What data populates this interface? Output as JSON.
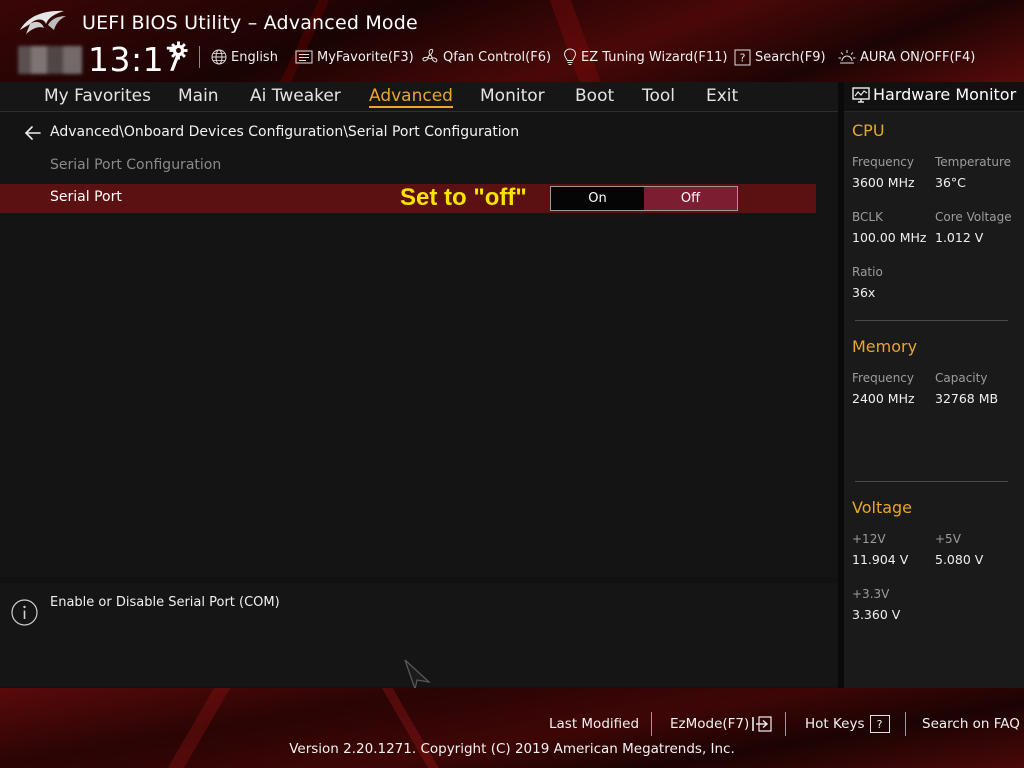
{
  "header": {
    "title": "UEFI BIOS Utility – Advanced Mode",
    "clock": "13:17",
    "items": {
      "language": "English",
      "my_favorite": "MyFavorite(F3)",
      "qfan": "Qfan Control(F6)",
      "ez_tuning": "EZ Tuning Wizard(F11)",
      "search": "Search(F9)",
      "aura": "AURA ON/OFF(F4)"
    }
  },
  "menu": {
    "tabs": [
      "My Favorites",
      "Main",
      "Ai Tweaker",
      "Advanced",
      "Monitor",
      "Boot",
      "Tool",
      "Exit"
    ],
    "active": "Advanced"
  },
  "main": {
    "breadcrumb": "Advanced\\Onboard Devices Configuration\\Serial Port Configuration",
    "section_label": "Serial Port Configuration",
    "setting": {
      "label": "Serial Port",
      "annotation": "Set to \"off\"",
      "options": [
        "On",
        "Off"
      ],
      "selected": "Off"
    }
  },
  "help": {
    "text": "Enable or Disable Serial Port (COM)"
  },
  "hardware_monitor": {
    "title": "Hardware Monitor",
    "cpu": {
      "heading": "CPU",
      "frequency_label": "Frequency",
      "frequency": "3600 MHz",
      "temperature_label": "Temperature",
      "temperature": "36°C",
      "bclk_label": "BCLK",
      "bclk": "100.00 MHz",
      "core_voltage_label": "Core Voltage",
      "core_voltage": "1.012 V",
      "ratio_label": "Ratio",
      "ratio": "36x"
    },
    "memory": {
      "heading": "Memory",
      "frequency_label": "Frequency",
      "frequency": "2400 MHz",
      "capacity_label": "Capacity",
      "capacity": "32768 MB"
    },
    "voltage": {
      "heading": "Voltage",
      "v12_label": "+12V",
      "v12": "11.904 V",
      "v5_label": "+5V",
      "v5": "5.080 V",
      "v33_label": "+3.3V",
      "v33": "3.360 V"
    }
  },
  "footer": {
    "last_modified": "Last Modified",
    "ez_mode": "EzMode(F7)",
    "hot_keys": "Hot Keys",
    "hot_keys_key": "?",
    "search_faq": "Search on FAQ",
    "copyright": "Version 2.20.1271. Copyright (C) 2019 American Megatrends, Inc."
  },
  "colors": {
    "accent": "#e9a62b",
    "selected_row": "#5b1012",
    "toggle_selected": "#7c1d31",
    "annotation": "#f5e400"
  }
}
